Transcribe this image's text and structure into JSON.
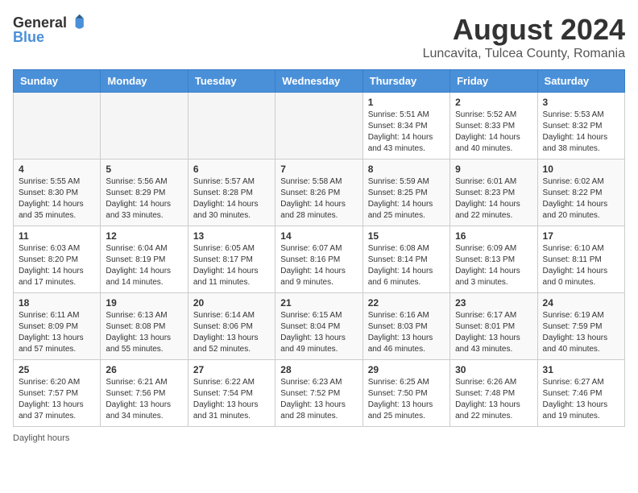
{
  "header": {
    "logo_general": "General",
    "logo_blue": "Blue",
    "title": "August 2024",
    "subtitle": "Luncavita, Tulcea County, Romania"
  },
  "days_of_week": [
    "Sunday",
    "Monday",
    "Tuesday",
    "Wednesday",
    "Thursday",
    "Friday",
    "Saturday"
  ],
  "weeks": [
    [
      {
        "day": "",
        "info": ""
      },
      {
        "day": "",
        "info": ""
      },
      {
        "day": "",
        "info": ""
      },
      {
        "day": "",
        "info": ""
      },
      {
        "day": "1",
        "info": "Sunrise: 5:51 AM\nSunset: 8:34 PM\nDaylight: 14 hours and 43 minutes."
      },
      {
        "day": "2",
        "info": "Sunrise: 5:52 AM\nSunset: 8:33 PM\nDaylight: 14 hours and 40 minutes."
      },
      {
        "day": "3",
        "info": "Sunrise: 5:53 AM\nSunset: 8:32 PM\nDaylight: 14 hours and 38 minutes."
      }
    ],
    [
      {
        "day": "4",
        "info": "Sunrise: 5:55 AM\nSunset: 8:30 PM\nDaylight: 14 hours and 35 minutes."
      },
      {
        "day": "5",
        "info": "Sunrise: 5:56 AM\nSunset: 8:29 PM\nDaylight: 14 hours and 33 minutes."
      },
      {
        "day": "6",
        "info": "Sunrise: 5:57 AM\nSunset: 8:28 PM\nDaylight: 14 hours and 30 minutes."
      },
      {
        "day": "7",
        "info": "Sunrise: 5:58 AM\nSunset: 8:26 PM\nDaylight: 14 hours and 28 minutes."
      },
      {
        "day": "8",
        "info": "Sunrise: 5:59 AM\nSunset: 8:25 PM\nDaylight: 14 hours and 25 minutes."
      },
      {
        "day": "9",
        "info": "Sunrise: 6:01 AM\nSunset: 8:23 PM\nDaylight: 14 hours and 22 minutes."
      },
      {
        "day": "10",
        "info": "Sunrise: 6:02 AM\nSunset: 8:22 PM\nDaylight: 14 hours and 20 minutes."
      }
    ],
    [
      {
        "day": "11",
        "info": "Sunrise: 6:03 AM\nSunset: 8:20 PM\nDaylight: 14 hours and 17 minutes."
      },
      {
        "day": "12",
        "info": "Sunrise: 6:04 AM\nSunset: 8:19 PM\nDaylight: 14 hours and 14 minutes."
      },
      {
        "day": "13",
        "info": "Sunrise: 6:05 AM\nSunset: 8:17 PM\nDaylight: 14 hours and 11 minutes."
      },
      {
        "day": "14",
        "info": "Sunrise: 6:07 AM\nSunset: 8:16 PM\nDaylight: 14 hours and 9 minutes."
      },
      {
        "day": "15",
        "info": "Sunrise: 6:08 AM\nSunset: 8:14 PM\nDaylight: 14 hours and 6 minutes."
      },
      {
        "day": "16",
        "info": "Sunrise: 6:09 AM\nSunset: 8:13 PM\nDaylight: 14 hours and 3 minutes."
      },
      {
        "day": "17",
        "info": "Sunrise: 6:10 AM\nSunset: 8:11 PM\nDaylight: 14 hours and 0 minutes."
      }
    ],
    [
      {
        "day": "18",
        "info": "Sunrise: 6:11 AM\nSunset: 8:09 PM\nDaylight: 13 hours and 57 minutes."
      },
      {
        "day": "19",
        "info": "Sunrise: 6:13 AM\nSunset: 8:08 PM\nDaylight: 13 hours and 55 minutes."
      },
      {
        "day": "20",
        "info": "Sunrise: 6:14 AM\nSunset: 8:06 PM\nDaylight: 13 hours and 52 minutes."
      },
      {
        "day": "21",
        "info": "Sunrise: 6:15 AM\nSunset: 8:04 PM\nDaylight: 13 hours and 49 minutes."
      },
      {
        "day": "22",
        "info": "Sunrise: 6:16 AM\nSunset: 8:03 PM\nDaylight: 13 hours and 46 minutes."
      },
      {
        "day": "23",
        "info": "Sunrise: 6:17 AM\nSunset: 8:01 PM\nDaylight: 13 hours and 43 minutes."
      },
      {
        "day": "24",
        "info": "Sunrise: 6:19 AM\nSunset: 7:59 PM\nDaylight: 13 hours and 40 minutes."
      }
    ],
    [
      {
        "day": "25",
        "info": "Sunrise: 6:20 AM\nSunset: 7:57 PM\nDaylight: 13 hours and 37 minutes."
      },
      {
        "day": "26",
        "info": "Sunrise: 6:21 AM\nSunset: 7:56 PM\nDaylight: 13 hours and 34 minutes."
      },
      {
        "day": "27",
        "info": "Sunrise: 6:22 AM\nSunset: 7:54 PM\nDaylight: 13 hours and 31 minutes."
      },
      {
        "day": "28",
        "info": "Sunrise: 6:23 AM\nSunset: 7:52 PM\nDaylight: 13 hours and 28 minutes."
      },
      {
        "day": "29",
        "info": "Sunrise: 6:25 AM\nSunset: 7:50 PM\nDaylight: 13 hours and 25 minutes."
      },
      {
        "day": "30",
        "info": "Sunrise: 6:26 AM\nSunset: 7:48 PM\nDaylight: 13 hours and 22 minutes."
      },
      {
        "day": "31",
        "info": "Sunrise: 6:27 AM\nSunset: 7:46 PM\nDaylight: 13 hours and 19 minutes."
      }
    ]
  ],
  "footer": {
    "daylight_label": "Daylight hours"
  }
}
